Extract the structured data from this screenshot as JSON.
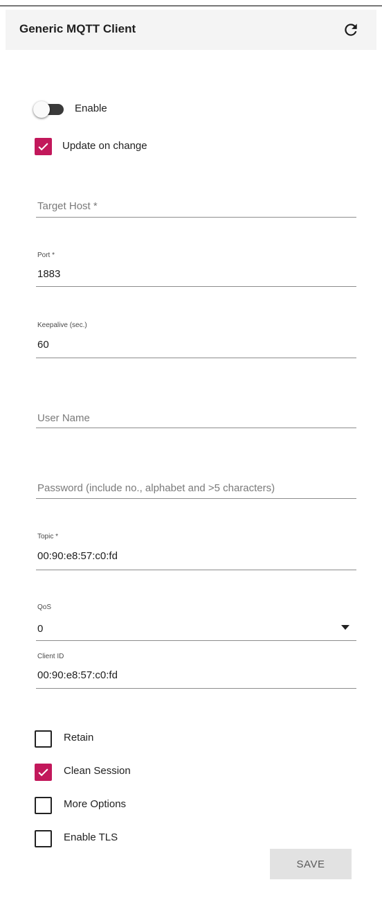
{
  "header": {
    "title": "Generic MQTT Client",
    "refresh_icon": "refresh-icon"
  },
  "enable": {
    "label": "Enable",
    "checked": false
  },
  "update_on_change": {
    "label": "Update on change",
    "checked": true
  },
  "fields": {
    "target_host": {
      "placeholder": "Target Host *",
      "value": ""
    },
    "port": {
      "label": "Port *",
      "value": "1883"
    },
    "keepalive": {
      "label": "Keepalive (sec.)",
      "value": "60"
    },
    "user_name": {
      "placeholder": "User Name",
      "value": ""
    },
    "password": {
      "placeholder": "Password (include no., alphabet and >5 characters)",
      "value": ""
    },
    "topic": {
      "label": "Topic *",
      "value": "00:90:e8:57:c0:fd"
    },
    "qos": {
      "label": "QoS",
      "value": "0"
    },
    "client_id": {
      "label": "Client ID",
      "value": "00:90:e8:57:c0:fd"
    }
  },
  "options": {
    "retain": {
      "label": "Retain",
      "checked": false
    },
    "clean_session": {
      "label": "Clean Session",
      "checked": true
    },
    "more_options": {
      "label": "More Options",
      "checked": false
    },
    "enable_tls": {
      "label": "Enable TLS",
      "checked": false
    }
  },
  "save_label": "SAVE",
  "colors": {
    "accent": "#c2185b",
    "header_bg": "#f4f4f4",
    "button_bg": "#e2e2e2"
  }
}
